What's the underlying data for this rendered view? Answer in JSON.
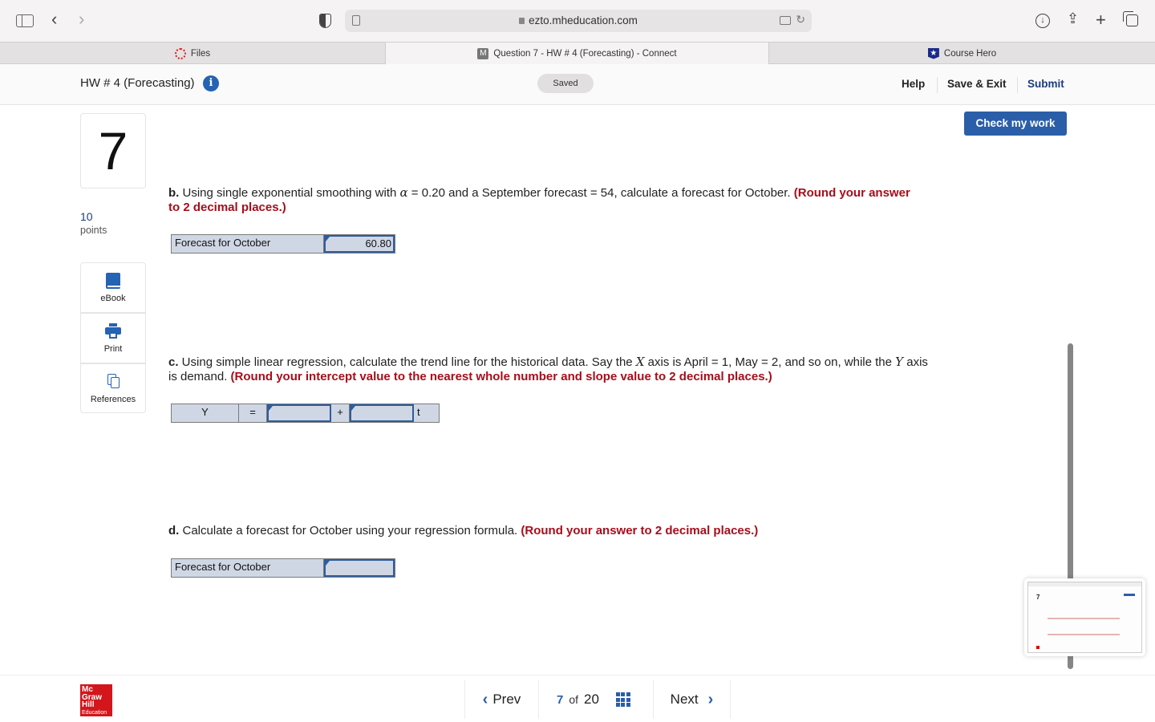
{
  "browser": {
    "url": "ezto.mheducation.com",
    "tabs": [
      {
        "label": "Files",
        "icon": "files-favicon"
      },
      {
        "label": "Question 7 - HW # 4 (Forecasting) - Connect",
        "icon": "mheducation-favicon",
        "active": true
      },
      {
        "label": "Course Hero",
        "icon": "coursehero-favicon"
      }
    ],
    "favicon_letter_m": "M",
    "favicon_star": "★"
  },
  "header": {
    "assignment_title": "HW # 4 (Forecasting)",
    "info_glyph": "i",
    "status": "Saved",
    "help_label": "Help",
    "save_exit_label": "Save & Exit",
    "submit_label": "Submit"
  },
  "question": {
    "number": "7",
    "points_value": "10",
    "points_label": "points",
    "check_button": "Check my work"
  },
  "tools": [
    {
      "label": "eBook",
      "icon": "book-icon"
    },
    {
      "label": "Print",
      "icon": "printer-icon"
    },
    {
      "label": "References",
      "icon": "copies-icon"
    }
  ],
  "parts": {
    "b": {
      "lead": "b.",
      "text_1": " Using single exponential smoothing with ",
      "alpha_symbol": "α",
      "text_2": " = 0.20 and a September forecast = 54, calculate a forecast for October. ",
      "instruction": "(Round your answer to 2 decimal places.)",
      "row_label": "Forecast for October",
      "answer_value": "60.80"
    },
    "c": {
      "lead": "c.",
      "text_1": " Using simple linear regression, calculate the trend line for the historical data. Say the ",
      "x_var": "X",
      "text_2": " axis is April = 1, May = 2, and so on, while the ",
      "y_var": "Y",
      "text_3": " axis is demand. ",
      "instruction": "(Round your intercept value to the nearest whole number and slope value to 2 decimal places.)",
      "eq_y": "Y",
      "eq_equals": "=",
      "intercept_value": "",
      "eq_plus": "+",
      "slope_value": "",
      "eq_t": "t"
    },
    "d": {
      "lead": "d.",
      "text_1": " Calculate a forecast for October using your regression formula. ",
      "instruction": "(Round your answer to 2 decimal places.)",
      "row_label": "Forecast for October",
      "answer_value": ""
    }
  },
  "footer": {
    "logo_lines": [
      "Mc",
      "Graw",
      "Hill",
      "Education"
    ],
    "prev_label": "Prev",
    "current_page": "7",
    "of_label": "of",
    "total_pages": "20",
    "next_label": "Next",
    "prev_chevron": "‹",
    "next_chevron": "›"
  },
  "colors": {
    "accent_blue": "#2b5ea8",
    "instruction_red": "#a80d1a",
    "submit_navy": "#1d3d7a",
    "answer_cell_bg": "#d0d7e4",
    "mh_red": "#d3161c"
  }
}
